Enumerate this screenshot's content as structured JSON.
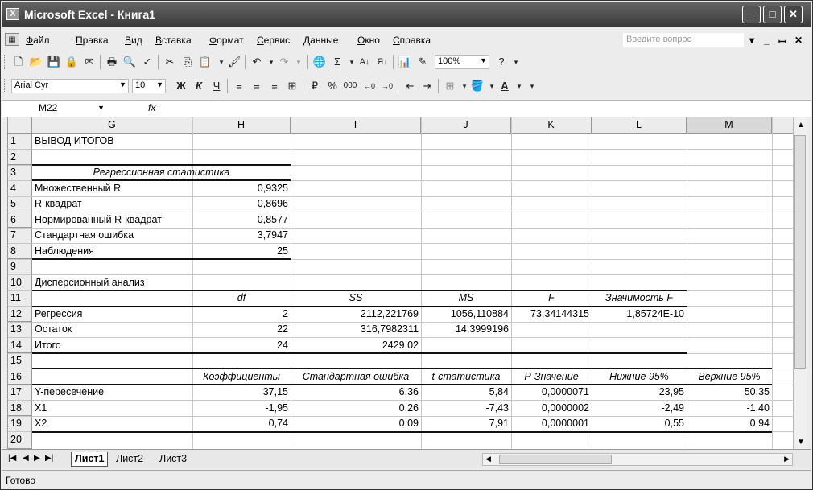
{
  "window": {
    "title": "Microsoft Excel - Книга1",
    "minimize": "_",
    "maximize": "□",
    "close": "✕"
  },
  "menu": [
    "Файл",
    "Правка",
    "Вид",
    "Вставка",
    "Формат",
    "Сервис",
    "Данные",
    "Окно",
    "Справка"
  ],
  "ask_placeholder": "Введите вопрос",
  "doc_controls": [
    "▾",
    "_",
    "ꟷ",
    "✕"
  ],
  "toolbar": {
    "zoom": "100%",
    "font_name": "Arial Cyr",
    "font_size": "10",
    "bold": "Ж",
    "italic": "К",
    "underline": "Ч",
    "percent": "%",
    "thousands": "000"
  },
  "formula_bar": {
    "name_box": "M22",
    "fx": "fx",
    "content": ""
  },
  "columns": [
    "G",
    "H",
    "I",
    "J",
    "K",
    "L",
    "M"
  ],
  "rows": [
    "1",
    "2",
    "3",
    "4",
    "5",
    "6",
    "7",
    "8",
    "9",
    "10",
    "11",
    "12",
    "13",
    "14",
    "15",
    "16",
    "17",
    "18",
    "19",
    "20"
  ],
  "cells": {
    "G1": "ВЫВОД ИТОГОВ",
    "G3": "Регрессионная статистика",
    "G4": "Множественный R",
    "H4": "0,9325",
    "G5": "R-квадрат",
    "H5": "0,8696",
    "G6": "Нормированный R-квадрат",
    "H6": "0,8577",
    "G7": "Стандартная ошибка",
    "H7": "3,7947",
    "G8": "Наблюдения",
    "H8": "25",
    "G10": "Дисперсионный анализ",
    "H11": "df",
    "I11": "SS",
    "J11": "MS",
    "K11": "F",
    "L11": "Значимость F",
    "G12": "Регрессия",
    "H12": "2",
    "I12": "2112,221769",
    "J12": "1056,110884",
    "K12": "73,34144315",
    "L12": "1,85724E-10",
    "G13": "Остаток",
    "H13": "22",
    "I13": "316,7982311",
    "J13": "14,3999196",
    "G14": "Итого",
    "H14": "24",
    "I14": "2429,02",
    "H16": "Коэффициенты",
    "I16": "Стандартная ошибка",
    "J16": "t-статистика",
    "K16": "P-Значение",
    "L16": "Нижние 95%",
    "M16": "Верхние 95%",
    "G17": "Y-пересечение",
    "H17": "37,15",
    "I17": "6,36",
    "J17": "5,84",
    "K17": "0,0000071",
    "L17": "23,95",
    "M17": "50,35",
    "G18": "X1",
    "H18": "-1,95",
    "I18": "0,26",
    "J18": "-7,43",
    "K18": "0,0000002",
    "L18": "-2,49",
    "M18": "-1,40",
    "G19": "X2",
    "H19": "0,74",
    "I19": "0,09",
    "J19": "7,91",
    "K19": "0,0000001",
    "L19": "0,55",
    "M19": "0,94"
  },
  "sheets": [
    "Лист1",
    "Лист2",
    "Лист3"
  ],
  "status": "Готово"
}
